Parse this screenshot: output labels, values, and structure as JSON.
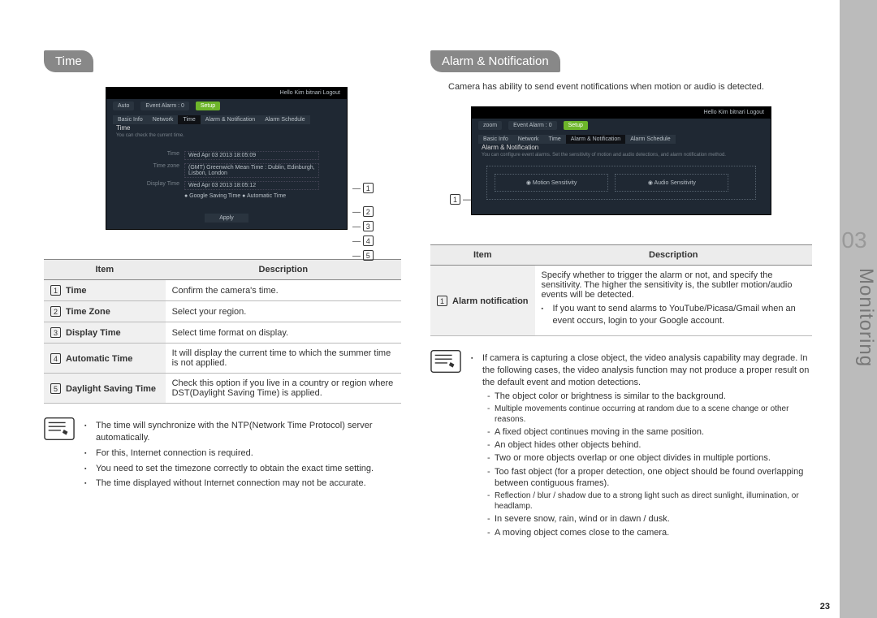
{
  "sidebar": {
    "chapter": "03",
    "title": "Monitoring"
  },
  "page_number": "23",
  "left": {
    "heading": "Time",
    "screenshot": {
      "topbar": "Hello Kim bitnari   Logout",
      "menu": {
        "monitor": "Auto",
        "alarm": "Event Alarm : 0",
        "setup": "Setup"
      },
      "tabs": {
        "basic": "Basic Info",
        "network": "Network",
        "time": "Time",
        "alarm": "Alarm & Notification",
        "sched": "Alarm Schedule"
      },
      "title": "Time",
      "subtitle": "You can check the current time.",
      "fields": {
        "f1l": "Time",
        "f1v": "Wed Apr 03 2013 18:05:09",
        "f2l": "Time zone",
        "f2v": "(GMT) Greenwich Mean Time : Dublin, Edinburgh, Lisbon, London",
        "f3l": "Display Time",
        "f3v": "Wed Apr 03 2013 18:05:12",
        "f4l": "",
        "f4v": "● Google Saving Time   ● Automatic Time"
      },
      "apply": "Apply"
    },
    "callouts": {
      "c1": "1",
      "c2": "2",
      "c3": "3",
      "c4": "4",
      "c5": "5"
    },
    "table": {
      "h1": "Item",
      "h2": "Description",
      "rows": [
        {
          "n": "1",
          "item": "Time",
          "desc": "Confirm the camera's time."
        },
        {
          "n": "2",
          "item": "Time Zone",
          "desc": "Select your region."
        },
        {
          "n": "3",
          "item": "Display Time",
          "desc": "Select time format on display."
        },
        {
          "n": "4",
          "item": "Automatic Time",
          "desc": "It will display the current time to which the summer time is not applied."
        },
        {
          "n": "5",
          "item": "Daylight Saving Time",
          "desc": "Check this option if you live in a country or region where DST(Daylight Saving Time) is applied."
        }
      ]
    },
    "notes": {
      "n1": "The time will synchronize with the NTP(Network Time Protocol) server automatically.",
      "n2": "For this, Internet connection is required.",
      "n3": "You need to set the timezone correctly to obtain the exact time setting.",
      "n4": "The time displayed without Internet connection may not be accurate."
    }
  },
  "right": {
    "heading": "Alarm & Notification",
    "intro": "Camera has ability to send event notifications when motion or audio is detected.",
    "screenshot": {
      "topbar": "Hello Kim bitnari   Logout",
      "menu": {
        "monitor": "zoom",
        "alarm": "Event Alarm : 0",
        "setup": "Setup"
      },
      "tabs": {
        "basic": "Basic Info",
        "network": "Network",
        "time": "Time",
        "alarm": "Alarm & Notification",
        "sched": "Alarm Schedule"
      },
      "title": "Alarm & Notification",
      "subtitle": "You can configure event alarms. Set the sensitivity of motion and audio detections, and alarm notification method.",
      "box1": "◉ Motion Sensitivity",
      "box2": "◉ Audio Sensitivity"
    },
    "callouts": {
      "c1": "1"
    },
    "table": {
      "h1": "Item",
      "h2": "Description",
      "rows": [
        {
          "n": "1",
          "item": "Alarm notification",
          "desc": "Specify whether to trigger the alarm or not, and specify the sensitivity. The higher the sensitivity is, the subtler motion/audio events will be detected.",
          "sub": "If you want to send alarms to YouTube/Picasa/Gmail when an event occurs, login to your Google account."
        }
      ]
    },
    "notes": {
      "n0": "If camera is capturing a close object, the video analysis capability may degrade. In the following cases, the video analysis function may not produce a proper result on the default event and motion detections.",
      "d1": "The object color or brightness is similar to the background.",
      "d2": "Multiple movements continue occurring at random due to a scene change or other reasons.",
      "d3": "A fixed object continues moving in the same position.",
      "d4": "An object hides other objects behind.",
      "d5": "Two or more objects overlap or one object divides in multiple portions.",
      "d6": "Too fast object (for a proper detection, one object should be found overlapping between contiguous frames).",
      "d7": "Reflection / blur / shadow due to a strong light such as direct sunlight, illumination, or headlamp.",
      "d8": "In severe snow, rain, wind or in dawn / dusk.",
      "d9": "A moving object comes close to the camera."
    }
  }
}
